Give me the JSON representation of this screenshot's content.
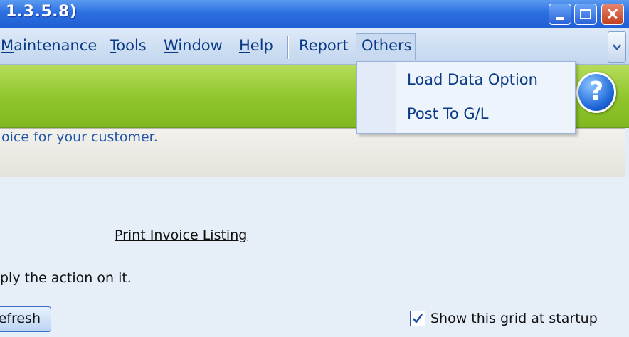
{
  "window": {
    "title": "1.3.5.8)",
    "minimize_icon": "minimize-icon",
    "maximize_icon": "maximize-icon",
    "close_icon": "close-icon"
  },
  "menu": {
    "maintenance": {
      "first": "M",
      "rest": "aintenance"
    },
    "tools": {
      "first": "T",
      "rest": "ools"
    },
    "window": {
      "first": "W",
      "rest": "indow"
    },
    "help": {
      "first": "H",
      "rest": "elp"
    },
    "report": "Report",
    "others": "Others",
    "overflow_icon": "chevron-down-icon"
  },
  "others_menu": {
    "items": [
      "Load Data Option",
      "Post To G/L"
    ]
  },
  "banner": {
    "help_glyph": "?",
    "help_icon": "help-icon"
  },
  "description": "oice for your customer.",
  "main": {
    "print_link": "Print Invoice Listing",
    "instruction": "ply the action on it.",
    "refresh_label": "efresh",
    "show_grid_label": "Show this grid at startup",
    "show_grid_checked": true
  },
  "colors": {
    "titlebar": "#2c6fe0",
    "banner": "#8fc52b",
    "menu_text": "#0a3a86",
    "link_text": "#1f54a8"
  }
}
